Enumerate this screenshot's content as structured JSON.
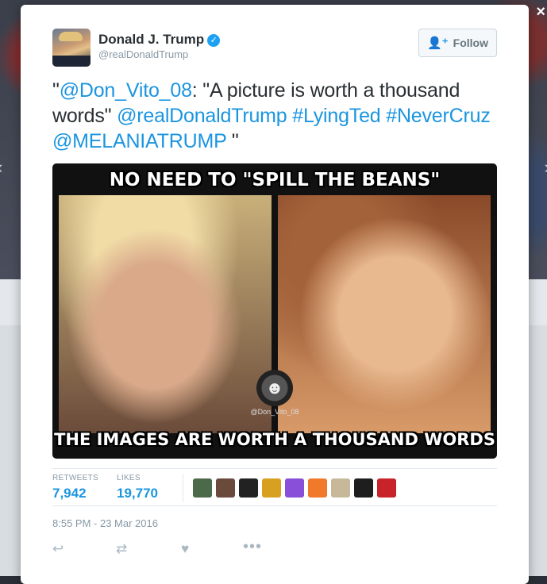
{
  "tweet": {
    "author": {
      "display_name": "Donald J. Trump",
      "handle": "@realDonaldTrump",
      "verified": true
    },
    "follow_button": {
      "label": "Follow",
      "icon": "add-user-icon"
    },
    "text_parts": [
      {
        "text": "\"",
        "type": "plain"
      },
      {
        "text": "@Don_Vito_08",
        "type": "mention"
      },
      {
        "text": ": \"A picture is worth a thousand words\" ",
        "type": "plain"
      },
      {
        "text": "@realDonaldTrump",
        "type": "mention"
      },
      {
        "text": " ",
        "type": "plain"
      },
      {
        "text": "#LyingTed",
        "type": "hashtag"
      },
      {
        "text": " ",
        "type": "plain"
      },
      {
        "text": "#NeverCruz",
        "type": "hashtag"
      },
      {
        "text": " ",
        "type": "plain"
      },
      {
        "text": "@MELANIATRUMP",
        "type": "mention"
      },
      {
        "text": " \"",
        "type": "plain"
      }
    ],
    "media": {
      "top_caption": "NO NEED TO \"SPILL THE BEANS\"",
      "bottom_caption": "THE IMAGES ARE WORTH A THOUSAND WORDS",
      "watermark": "@Don_Vito_08"
    },
    "stats": {
      "retweets_label": "RETWEETS",
      "retweets_value": "7,942",
      "likes_label": "LIKES",
      "likes_value": "19,770",
      "liker_colors": [
        "#4a6a4a",
        "#6a4a3a",
        "#222222",
        "#d8a020",
        "#8a4fd8",
        "#f07a2a",
        "#c8b89a",
        "#1e1e1e",
        "#c8222a"
      ]
    },
    "timestamp": "8:55 PM - 23 Mar 2016",
    "actions": {
      "reply_icon": "reply-icon",
      "retweet_icon": "retweet-icon",
      "like_icon": "heart-icon",
      "more_icon": "more-icon"
    }
  }
}
